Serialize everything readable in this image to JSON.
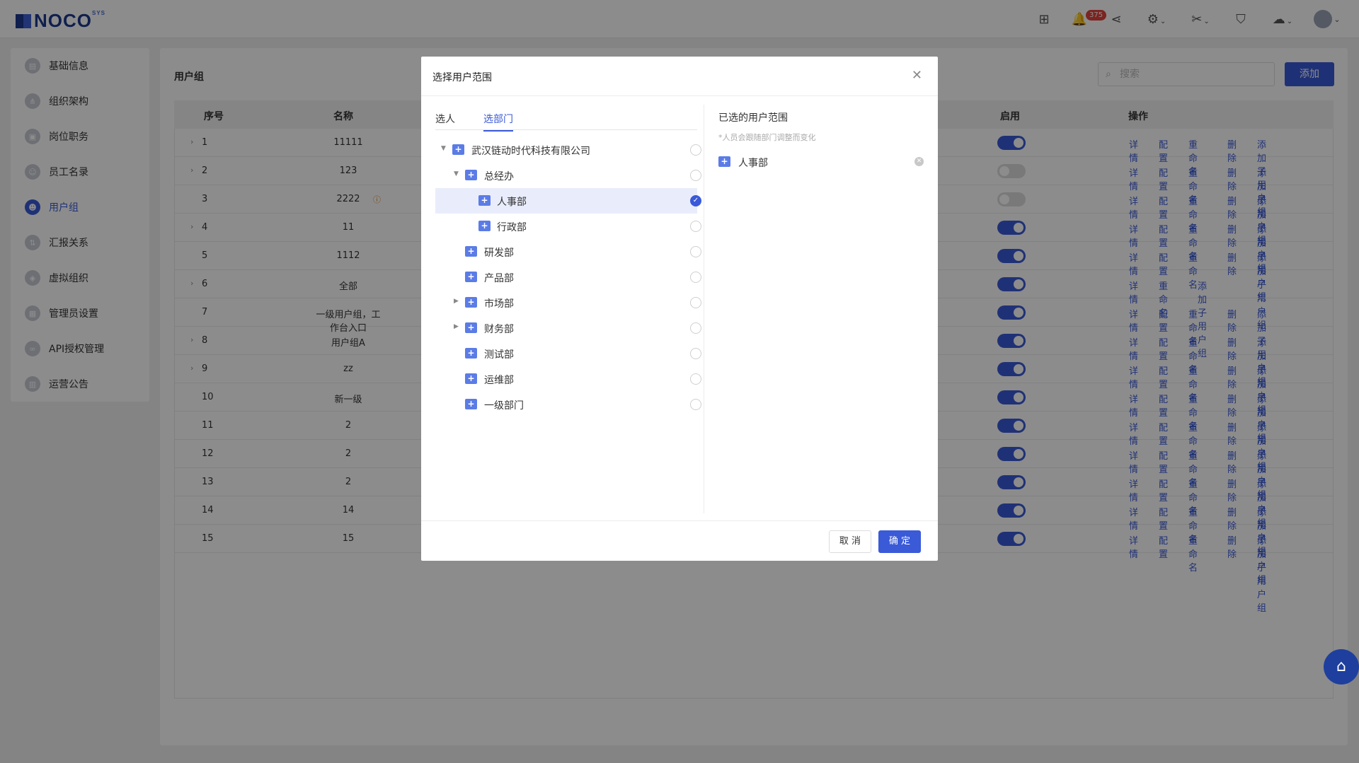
{
  "header": {
    "logo": "NOCO",
    "logo_sup": "SYS",
    "notification_count": "375"
  },
  "sidebar": {
    "items": [
      {
        "label": "基础信息"
      },
      {
        "label": "组织架构"
      },
      {
        "label": "岗位职务"
      },
      {
        "label": "员工名录"
      },
      {
        "label": "用户组"
      },
      {
        "label": "汇报关系"
      },
      {
        "label": "虚拟组织"
      },
      {
        "label": "管理员设置"
      },
      {
        "label": "API授权管理"
      },
      {
        "label": "运营公告"
      }
    ]
  },
  "main": {
    "title": "用户组",
    "search_placeholder": "搜索",
    "add_label": "添加",
    "columns": {
      "index": "序号",
      "name": "名称",
      "enabled": "启用",
      "ops": "操作"
    },
    "ops_labels": {
      "detail": "详情",
      "config": "配置",
      "rename": "重命名",
      "delete": "删除",
      "add_sub": "添加子用户组"
    },
    "rows": [
      {
        "index": "1",
        "name": "11111",
        "enabled": true
      },
      {
        "index": "2",
        "name": "123",
        "enabled": false
      },
      {
        "index": "3",
        "name": "2222",
        "enabled": false
      },
      {
        "index": "4",
        "name": "11",
        "enabled": true
      },
      {
        "index": "5",
        "name": "1112",
        "enabled": true
      },
      {
        "index": "6",
        "name": "全部",
        "enabled": true
      },
      {
        "index": "7",
        "name": "一级用户组，工作台入口",
        "enabled": true
      },
      {
        "index": "8",
        "name": "用户组A",
        "enabled": true
      },
      {
        "index": "9",
        "name": "zz",
        "enabled": true
      },
      {
        "index": "10",
        "name": "新一级",
        "enabled": true
      },
      {
        "index": "11",
        "name": "2",
        "enabled": true
      },
      {
        "index": "12",
        "name": "2",
        "enabled": true
      },
      {
        "index": "13",
        "name": "2",
        "enabled": true
      },
      {
        "index": "14",
        "name": "14",
        "enabled": true
      },
      {
        "index": "15",
        "name": "15",
        "enabled": true
      }
    ]
  },
  "modal": {
    "title": "选择用户范围",
    "tabs": {
      "person": "选人",
      "dept": "选部门"
    },
    "tree": {
      "root": "武汉链动时代科技有限公司",
      "zjb": "总经办",
      "rsb": "人事部",
      "xzb": "行政部",
      "yfb": "研发部",
      "cpb": "产品部",
      "scb": "市场部",
      "cwb": "财务部",
      "csb": "测试部",
      "ywb": "运维部",
      "yjbm": "一级部门"
    },
    "selected_title": "已选的用户范围",
    "selected_note": "*人员会跟随部门调整而变化",
    "selected": [
      "人事部"
    ],
    "cancel": "取 消",
    "confirm": "确 定"
  }
}
